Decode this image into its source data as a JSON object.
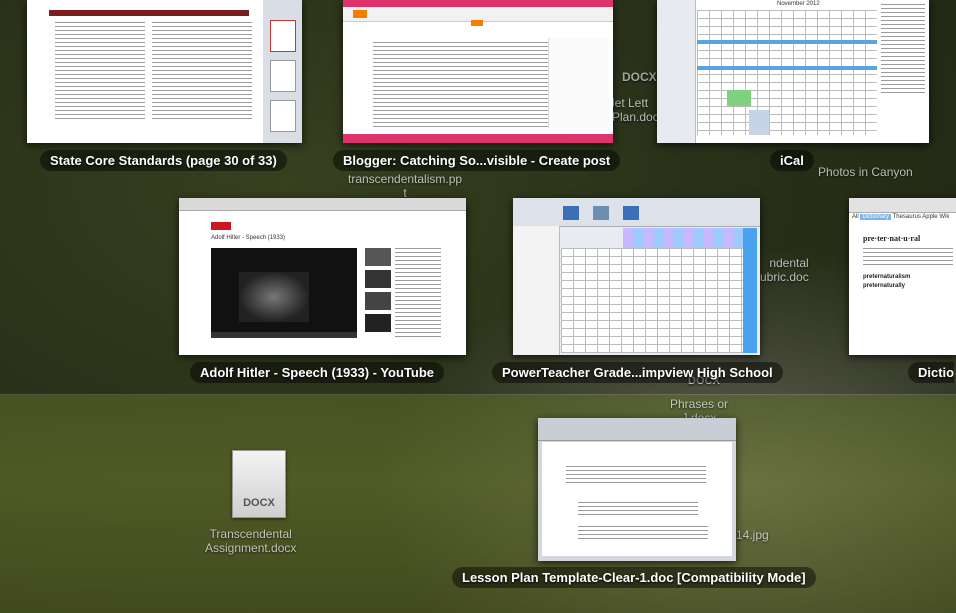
{
  "windows": [
    {
      "id": "state-core",
      "label": "State Core Standards (page 30 of 33)"
    },
    {
      "id": "blogger",
      "label": "Blogger: Catching So...visible - Create post"
    },
    {
      "id": "ical",
      "label": "iCal",
      "calendar_month": "November 2012"
    },
    {
      "id": "youtube",
      "label": "Adolf Hitler - Speech (1933) - YouTube",
      "video_title": "Adolf Hitler - Speech (1933)"
    },
    {
      "id": "powerteacher",
      "label": "PowerTeacher Grade...impview High School"
    },
    {
      "id": "dictionary",
      "label": "Dictio",
      "tabs": [
        "All",
        "Dictionary",
        "Thesaurus",
        "Apple",
        "Wik"
      ],
      "entry": "pre·ter·nat·u·ral",
      "related": [
        "preternaturalism",
        "preternaturally"
      ]
    },
    {
      "id": "lesson-plan",
      "label": "Lesson Plan Template-Clear-1.doc [Compatibility Mode]"
    }
  ],
  "desktop": {
    "docx_top": "DOCX",
    "let_plan": "let Lett\nPlan.doc",
    "transcendentalism": "transcendentalism.pp\nt",
    "photos_in_canyon": "Photos in Canyon",
    "rubric": "ndental\nubric.doc",
    "phrases": "Phrases or\nJ.docx",
    "docx_mid": "DOCX",
    "jpg": "14.jpg",
    "docx_icon_label": "DOCX",
    "transcendental_assignment": "Transcendental\nAssignment.docx"
  }
}
